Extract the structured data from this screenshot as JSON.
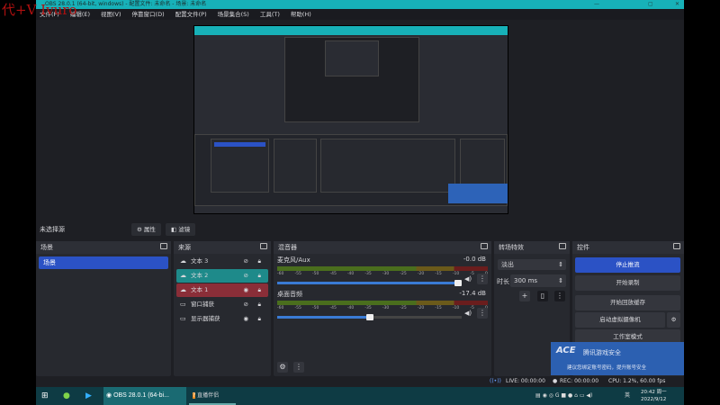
{
  "watermark": "代+V Ivuro",
  "window": {
    "title": "OBS 28.0.1 (64-bit, windows) - 配置文件: 未命名 - 场景: 未命名"
  },
  "menu": [
    "文件(F)",
    "编辑(E)",
    "视图(V)",
    "停靠窗口(D)",
    "配置文件(P)",
    "场景集合(S)",
    "工具(T)",
    "帮助(H)"
  ],
  "source_bar": {
    "label": "未选择源",
    "properties": "属性",
    "filters": "滤镜"
  },
  "scenes": {
    "title": "场景",
    "items": [
      "场景"
    ]
  },
  "sources": {
    "title": "来源",
    "items": [
      {
        "name": "文本 3",
        "icon": "text-icon",
        "visible": false,
        "locked": false,
        "state": "normal"
      },
      {
        "name": "文本 2",
        "icon": "text-icon",
        "visible": false,
        "locked": false,
        "state": "selected"
      },
      {
        "name": "文本 1",
        "icon": "text-icon",
        "visible": true,
        "locked": true,
        "state": "error"
      },
      {
        "name": "窗口捕获",
        "icon": "window-icon",
        "visible": false,
        "locked": true,
        "state": "normal"
      },
      {
        "name": "显示器捕获",
        "icon": "monitor-icon",
        "visible": true,
        "locked": false,
        "state": "normal"
      }
    ]
  },
  "mixer": {
    "title": "混音器",
    "ticks": [
      "-60",
      "-55",
      "-50",
      "-45",
      "-40",
      "-35",
      "-30",
      "-25",
      "-20",
      "-15",
      "-10",
      "-5",
      "0"
    ],
    "channels": [
      {
        "name": "麦克风/Aux",
        "db": "-0.0 dB",
        "volume": 1.0
      },
      {
        "name": "桌面音频",
        "db": "-17.4 dB",
        "volume": 0.52
      }
    ]
  },
  "transitions": {
    "title": "转场特效",
    "selected": "淡出",
    "duration_label": "时长",
    "duration": "300 ms"
  },
  "controls": {
    "title": "控件",
    "buttons": [
      "停止推流",
      "开始录制",
      "开始回放缓存",
      "启动虚拟摄像机",
      "工作室模式"
    ]
  },
  "status": {
    "live": "LIVE: 00:00:00",
    "rec": "REC: 00:00:00",
    "cpu": "CPU: 1.2%, 60.00 fps"
  },
  "toast": {
    "brand": "腾讯游戏安全",
    "message": "建议您绑定账号密码，提升账号安全"
  },
  "taskbar": {
    "apps": [
      "OBS 28.0.1 (64-bi...",
      "直播伴侣"
    ],
    "time": "20:42 周一",
    "date": "2022/9/12",
    "ime": "英"
  },
  "colors": {
    "accent": "#2b52c5",
    "titlebar": "#17b1b8",
    "selected_source": "#1e8a8a",
    "error_source": "#8a2e38"
  }
}
